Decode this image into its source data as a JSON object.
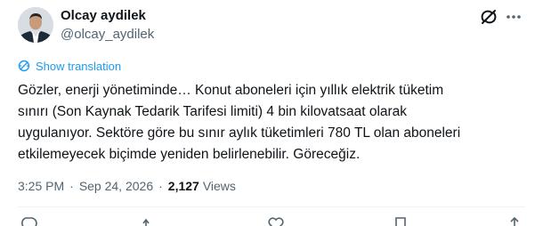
{
  "author": {
    "display_name": "Olcay aydilek",
    "handle": "@olcay_aydilek"
  },
  "translate_label": "Show translation",
  "tweet_lines": [
    "Gözler, enerji yönetiminde… Konut aboneleri için yıllık elektrik tüketim",
    "sınırı (Son Kaynak Tedarik Tarifesi limiti) 4 bin kilovatsaat olarak",
    "uygulanıyor. Sektöre göre bu sınır aylık tüketimleri 780 TL olan aboneleri",
    "etkilemeyecek biçimde yeniden belirlenebilir. Göreceğiz."
  ],
  "meta": {
    "time": "3:25 PM",
    "separator": "·",
    "date": "Sep 24, 2026",
    "views_count": "2,127",
    "views_label": "Views"
  },
  "colors": {
    "accent": "#1d9bf0",
    "text": "#0f1419",
    "secondary": "#536471"
  },
  "icons": {
    "grok": "grok-icon",
    "more": "more-icon",
    "translate": "globe-icon"
  }
}
